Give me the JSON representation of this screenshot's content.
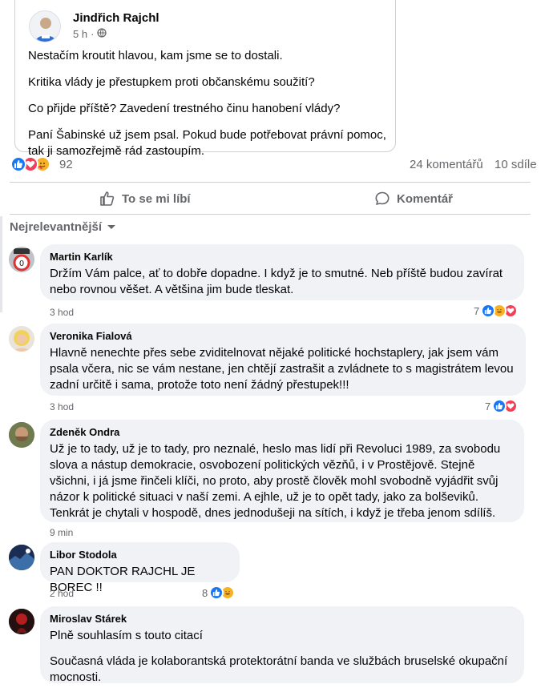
{
  "post": {
    "author": "Jindřich Rajchl",
    "time": "5 h",
    "audience_icon": "globe-icon",
    "paragraphs": [
      "Nestačím kroutit hlavou, kam jsme se to dostali.",
      "Kritika vlády je přestupkem proti občanskému soužití?",
      "Co přijde příště? Zavedení trestného činu hanobení vlády?",
      "Paní Šabinské už jsem psal. Pokud bude potřebovat právní pomoc, tak ji samozřejmě rád zastoupím."
    ]
  },
  "summary": {
    "reaction_count": "92",
    "comments": "24 komentářů",
    "shares": "10 sdíle"
  },
  "actions": {
    "like": "To se mi líbí",
    "comment": "Komentář"
  },
  "sort_label": "Nejrelevantnější",
  "colors": {
    "like": "#1877f2",
    "love": "#f33e58",
    "haha": "#f7b125"
  },
  "comments": [
    {
      "name": "Martin Karlík",
      "text": [
        "Držím Vám palce, ať to dobře dopadne. I když je to smutné. Neb příště budou zavírat nebo rovnou věšet. A většina jim bude tleskat."
      ],
      "time": "3 hod",
      "reactions": "7"
    },
    {
      "name": "Veronika Fialová",
      "text": [
        "Hlavně nenechte přes sebe zviditelnovat nějaké politické hochstaplery, jak jsem vám psala včera, nic se vám nestane, jen chtějí zastrašit a zvládnete to s magistrátem levou zadní určitě i sama, protože toto není žádný přestupek!!!"
      ],
      "time": "3 hod",
      "reactions": "7"
    },
    {
      "name": "Zdeněk Ondra",
      "text": [
        "Už je to tady, už je to tady, pro neznalé, heslo mas lidí při Revoluci 1989, za svobodu slova a nástup demokracie, osvobození politických vězňů, i v Prostějově. Stejně všichni, i já jsme řinčeli klíči, no proto, aby prostě člověk mohl svobodně vyjádřit svůj názor k politické situaci v naší zemi. A ejhle, už je to opět tady, jako za bolševiků. Tenkrát je chytali v hospodě, dnes jednodušeji na sítích, i když je třeba jenom sdílíš."
      ],
      "time": "9 min",
      "reactions": ""
    },
    {
      "name": "Libor Stodola",
      "text": [
        "PAN DOKTOR RAJCHL JE BOREC !!"
      ],
      "time": "2 hod",
      "reactions": "8"
    },
    {
      "name": "Miroslav Stárek",
      "text": [
        "Plně souhlasím s touto citací",
        "Současná vláda je kolaborantská protektorátní banda ve službách bruselské okupační mocnosti."
      ],
      "time": "",
      "reactions": ""
    }
  ]
}
